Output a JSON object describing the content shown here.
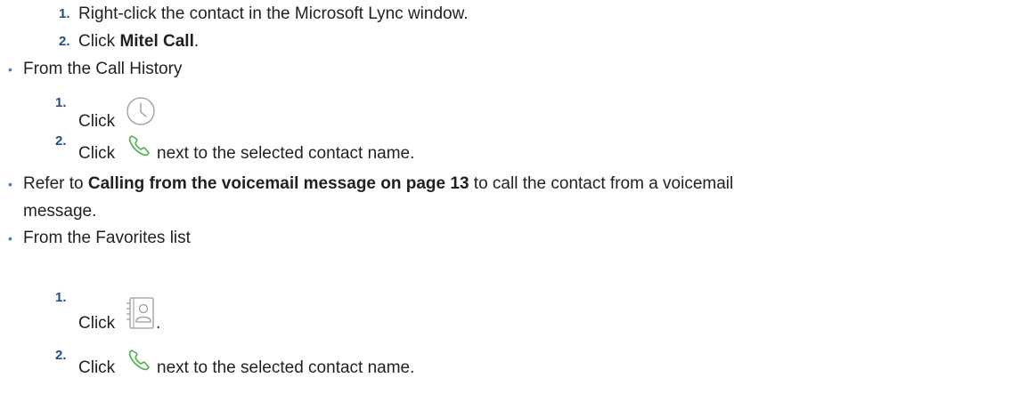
{
  "content": {
    "step1_num": "1.",
    "step1_text": "Right-click the contact in the Microsoft Lync window.",
    "step2_num": "2.",
    "step2_prefix": "Click ",
    "step2_bold": "Mitel Call",
    "step2_suffix": ".",
    "bullet_char": "•",
    "bullet1": "From the Call History",
    "ch_step1_num": "1.",
    "ch_step1_text": "Click",
    "ch_step2_num": "2.",
    "ch_step2_prefix": "Click",
    "ch_step2_suffix": "next to the selected contact name.",
    "bullet2_prefix": "Refer to ",
    "bullet2_bold": "Calling from the voicemail message on page 13",
    "bullet2_suffix": " to call the contact from a voicemail",
    "bullet2_cont": "message.",
    "bullet3": "From the Favorites list",
    "fav_step1_num": "1.",
    "fav_step1_text": "Click",
    "fav_step1_suffix": ".",
    "fav_step2_num": "2.",
    "fav_step2_prefix": "Click",
    "fav_step2_suffix": "next to the selected contact name."
  },
  "icons": {
    "clock": "clock-icon",
    "phone": "phone-icon",
    "contacts": "contacts-book-icon"
  },
  "colors": {
    "text": "#231f20",
    "number": "#1f4e8c",
    "bullet": "#4a7ab8",
    "phone_icon": "#4caf50",
    "icon_stroke": "#9a9a9a"
  }
}
